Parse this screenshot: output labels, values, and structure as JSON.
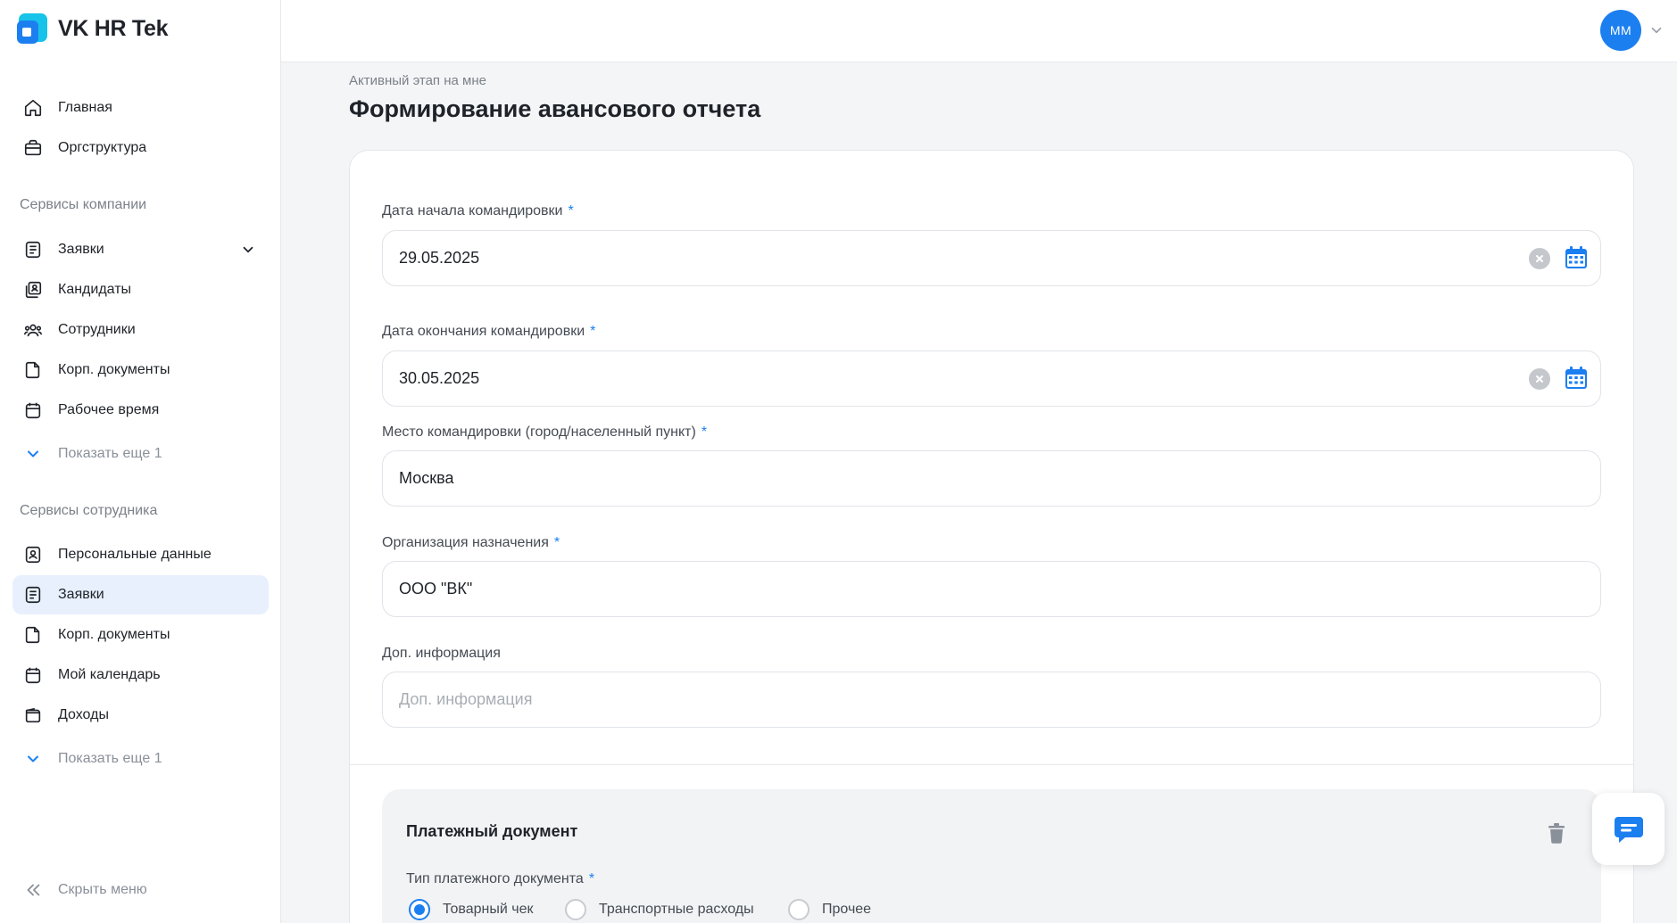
{
  "app": {
    "brand_name": "VK HR Tek"
  },
  "sidebar": {
    "main_items": [
      {
        "label": "Главная",
        "icon": "home-icon"
      },
      {
        "label": "Оргструктура",
        "icon": "briefcase-icon"
      }
    ],
    "company_section": {
      "title": "Сервисы компании",
      "items": [
        {
          "label": "Заявки",
          "icon": "list-icon",
          "expandable": true
        },
        {
          "label": "Кандидаты",
          "icon": "candidates-icon"
        },
        {
          "label": "Сотрудники",
          "icon": "people-icon"
        },
        {
          "label": "Корп. документы",
          "icon": "document-icon"
        },
        {
          "label": "Рабочее время",
          "icon": "calendar-icon"
        }
      ],
      "show_more": "Показать еще 1"
    },
    "employee_section": {
      "title": "Сервисы сотрудника",
      "items": [
        {
          "label": "Персональные данные",
          "icon": "person-card-icon"
        },
        {
          "label": "Заявки",
          "icon": "list-icon",
          "active": true
        },
        {
          "label": "Корп. документы",
          "icon": "document-icon"
        },
        {
          "label": "Мой календарь",
          "icon": "calendar-icon"
        },
        {
          "label": "Доходы",
          "icon": "wallet-icon"
        }
      ],
      "show_more": "Показать еще 1"
    },
    "collapse_label": "Скрыть меню"
  },
  "header": {
    "avatar_initials": "MM"
  },
  "page": {
    "stage_label": "Активный этап на мне",
    "title": "Формирование авансового отчета"
  },
  "form": {
    "start_date": {
      "label": "Дата начала командировки",
      "required": "*",
      "value": "29.05.2025"
    },
    "end_date": {
      "label": "Дата окончания командировки",
      "required": "*",
      "value": "30.05.2025"
    },
    "place": {
      "label": "Место командировки (город/населенный пункт)",
      "required": "*",
      "value": "Москва"
    },
    "organization": {
      "label": "Организация назначения",
      "required": "*",
      "value": "ООО \"ВК\""
    },
    "extra_info": {
      "label": "Доп. информация",
      "placeholder": "Доп. информация",
      "value": ""
    }
  },
  "payment_document": {
    "title": "Платежный документ",
    "type_label": "Тип платежного документа",
    "required": "*",
    "options": [
      "Товарный чек",
      "Транспортные расходы",
      "Прочее"
    ],
    "selected": "Товарный чек"
  },
  "colors": {
    "accent": "#1c7ff0",
    "active_bg": "#e8f0fd",
    "page_bg": "#f4f5f7"
  }
}
